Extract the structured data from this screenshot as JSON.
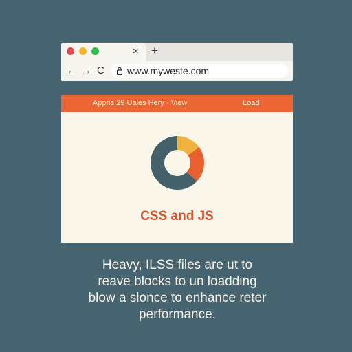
{
  "browser": {
    "tab_close": "×",
    "new_tab": "+",
    "nav": {
      "back": "←",
      "forward": "→",
      "reload": "C"
    },
    "url": "www.myweste.com",
    "traffic_lights": {
      "close_color": "#e5484d",
      "minimize_color": "#f5b72b",
      "maximize_color": "#2bc248"
    }
  },
  "page": {
    "nav_links_left": "Appris 29  Uales  Hery · View",
    "nav_link_right": "Load",
    "heading": "CSS and JS",
    "accent_color": "#ec6633",
    "donut": {
      "segments": [
        {
          "color": "#f2b23e",
          "value": 15
        },
        {
          "color": "#e8612f",
          "value": 22
        },
        {
          "color": "#43606b",
          "value": 63
        }
      ]
    }
  },
  "caption": {
    "lines": [
      "Heavy, ILSS files are ut to",
      "reave blocks to un loadding",
      "blow a slonce to enhance reter",
      "performance."
    ]
  }
}
